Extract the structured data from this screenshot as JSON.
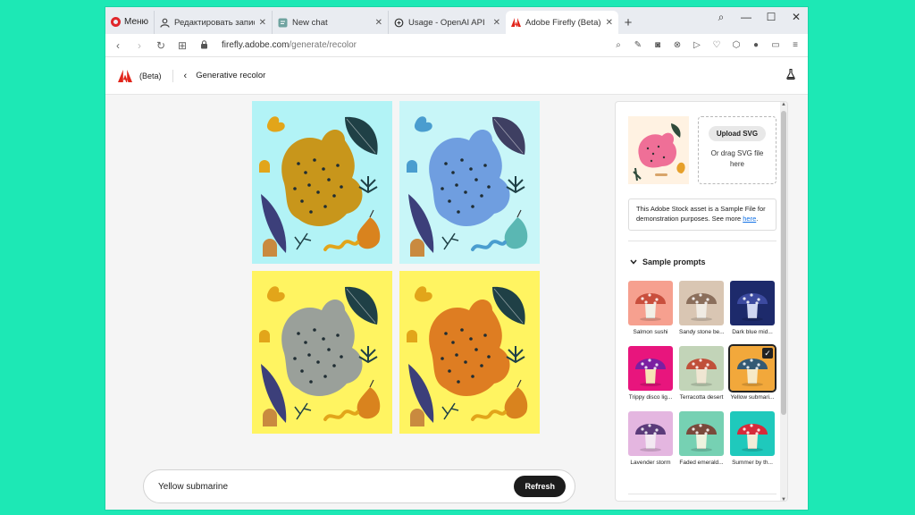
{
  "browser": {
    "menu_label": "Меню",
    "tabs": [
      {
        "label": "Редактировать запись \"Ма",
        "icon": "person-icon"
      },
      {
        "label": "New chat",
        "icon": "chat-icon"
      },
      {
        "label": "Usage - OpenAI API",
        "icon": "openai-icon"
      },
      {
        "label": "Adobe Firefly (Beta)",
        "icon": "adobe-icon",
        "active": true
      }
    ],
    "url_host": "firefly.adobe.com",
    "url_path": "/generate/recolor"
  },
  "header": {
    "beta_label": "(Beta)",
    "page_title": "Generative recolor"
  },
  "tiles": [
    {
      "bg": "#b2f3f6",
      "cat": "#c8961b",
      "leaf": "#1f4046",
      "accent": "#e2a51a",
      "pear": "#d9831e"
    },
    {
      "bg": "#c8f6f8",
      "cat": "#6f9ee0",
      "leaf": "#3e3f62",
      "accent": "#4a9dcf",
      "pear": "#5ab7b3"
    },
    {
      "bg": "#fff461",
      "cat": "#9aa09a",
      "leaf": "#1f4046",
      "accent": "#e2a51a",
      "pear": "#d9831e"
    },
    {
      "bg": "#fff461",
      "cat": "#de7d22",
      "leaf": "#1f4046",
      "accent": "#e2a51a",
      "pear": "#d9831e"
    }
  ],
  "prompt": {
    "value": "Yellow submarine",
    "refresh_label": "Refresh"
  },
  "panel": {
    "upload_label": "Upload SVG",
    "upload_hint": "Or drag SVG file here",
    "notice_text": "This Adobe Stock asset is a Sample File for demonstration purposes. See more ",
    "notice_link": "here",
    "notice_end": ".",
    "sample_prompts_title": "Sample prompts",
    "samples": [
      {
        "label": "Salmon sushi",
        "bg": "#f6a08f",
        "cap": "#c94f3d",
        "stem": "#f2efe6"
      },
      {
        "label": "Sandy stone be...",
        "bg": "#d9c6b3",
        "cap": "#8b6f5c",
        "stem": "#f0ebe3"
      },
      {
        "label": "Dark blue mid...",
        "bg": "#1d2a6b",
        "cap": "#3c4aa0",
        "stem": "#cfd6f2"
      },
      {
        "label": "Trippy disco lig...",
        "bg": "#e8157d",
        "cap": "#7b1fa2",
        "stem": "#f7e3b5"
      },
      {
        "label": "Terracotta desert",
        "bg": "#c2d4b8",
        "cap": "#c0503a",
        "stem": "#efe6d2"
      },
      {
        "label": "Yellow submari...",
        "bg": "#f2a83b",
        "cap": "#345a74",
        "stem": "#f6e9c7",
        "selected": true
      },
      {
        "label": "Lavender storm",
        "bg": "#e4b6e0",
        "cap": "#5b3b7a",
        "stem": "#f3e8f2"
      },
      {
        "label": "Faded emerald...",
        "bg": "#76d1b3",
        "cap": "#7a4a3c",
        "stem": "#eef3df"
      },
      {
        "label": "Summer by th...",
        "bg": "#1fc9bc",
        "cap": "#d62a3a",
        "stem": "#f3ecd8"
      }
    ]
  }
}
